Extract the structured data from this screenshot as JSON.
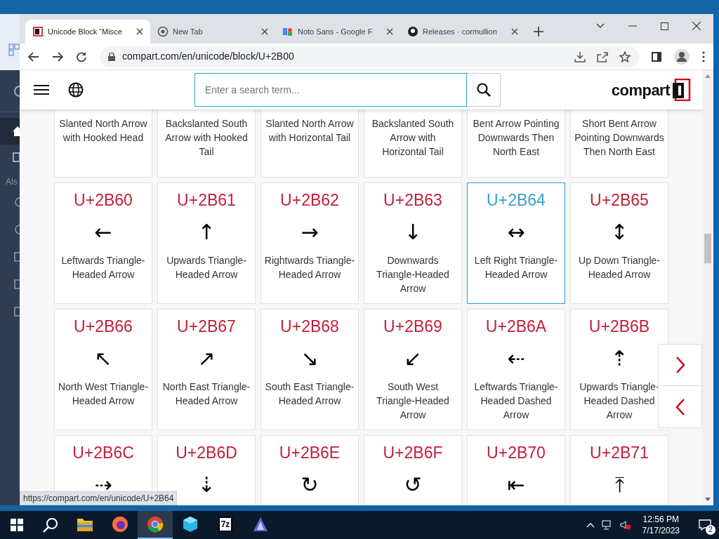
{
  "background_app": {
    "label": "Als"
  },
  "browser": {
    "tabs": [
      {
        "title": "Unicode Block “Misce",
        "selected": true
      },
      {
        "title": "New Tab",
        "selected": false
      },
      {
        "title": "Noto Sans - Google F",
        "selected": false
      },
      {
        "title": "Releases · cormullion",
        "selected": false
      }
    ],
    "url": "compart.com/en/unicode/block/U+2B00",
    "status_url": "https://compart.com/en/unicode/U+2B64"
  },
  "page": {
    "search": {
      "placeholder": "Enter a search term..."
    },
    "logo": "compart",
    "top_row": [
      {
        "name": "Slanted North Arrow with Hooked Head"
      },
      {
        "name": "Backslanted South Arrow with Hooked Tail"
      },
      {
        "name": "Slanted North Arrow with Horizontal Tail"
      },
      {
        "name": "Backslanted South Arrow with Horizontal Tail"
      },
      {
        "name": "Bent Arrow Pointing Downwards Then North East"
      },
      {
        "name": "Short Bent Arrow Pointing Downwards Then North East"
      }
    ],
    "cells": [
      {
        "code": "U+2B60",
        "glyph": "←",
        "name": "Leftwards Triangle-Headed Arrow",
        "highlighted": false
      },
      {
        "code": "U+2B61",
        "glyph": "↑",
        "name": "Upwards Triangle-Headed Arrow",
        "highlighted": false
      },
      {
        "code": "U+2B62",
        "glyph": "→",
        "name": "Rightwards Triangle-Headed Arrow",
        "highlighted": false
      },
      {
        "code": "U+2B63",
        "glyph": "↓",
        "name": "Downwards Triangle-Headed Arrow",
        "highlighted": false
      },
      {
        "code": "U+2B64",
        "glyph": "↔",
        "name": "Left Right Triangle-Headed Arrow",
        "highlighted": true
      },
      {
        "code": "U+2B65",
        "glyph": "↕",
        "name": "Up Down Triangle-Headed Arrow",
        "highlighted": false
      },
      {
        "code": "U+2B66",
        "glyph": "↖",
        "name": "North West Triangle-Headed Arrow",
        "highlighted": false
      },
      {
        "code": "U+2B67",
        "glyph": "↗",
        "name": "North East Triangle-Headed Arrow",
        "highlighted": false
      },
      {
        "code": "U+2B68",
        "glyph": "↘",
        "name": "South East Triangle-Headed Arrow",
        "highlighted": false
      },
      {
        "code": "U+2B69",
        "glyph": "↙",
        "name": "South West Triangle-Headed Arrow",
        "highlighted": false
      },
      {
        "code": "U+2B6A",
        "glyph": "⇠",
        "name": "Leftwards Triangle-Headed Dashed Arrow",
        "highlighted": false
      },
      {
        "code": "U+2B6B",
        "glyph": "⇡",
        "name": "Upwards Triangle-Headed Dashed Arrow",
        "highlighted": false
      }
    ],
    "bottom_row": [
      {
        "code": "U+2B6C",
        "glyph": "⇢"
      },
      {
        "code": "U+2B6D",
        "glyph": "⇣"
      },
      {
        "code": "U+2B6E",
        "glyph": "↻"
      },
      {
        "code": "U+2B6F",
        "glyph": "↺"
      },
      {
        "code": "U+2B70",
        "glyph": "⇤"
      },
      {
        "code": "U+2B71",
        "glyph": "⤒"
      }
    ]
  },
  "taskbar": {
    "apps": [
      {
        "selected": false
      },
      {
        "selected": false
      },
      {
        "selected": true
      },
      {
        "selected": false
      },
      {
        "label": "7z",
        "selected": false
      },
      {
        "selected": false
      }
    ],
    "time": "12:56 PM",
    "date": "7/17/2023",
    "notifications": "2"
  }
}
